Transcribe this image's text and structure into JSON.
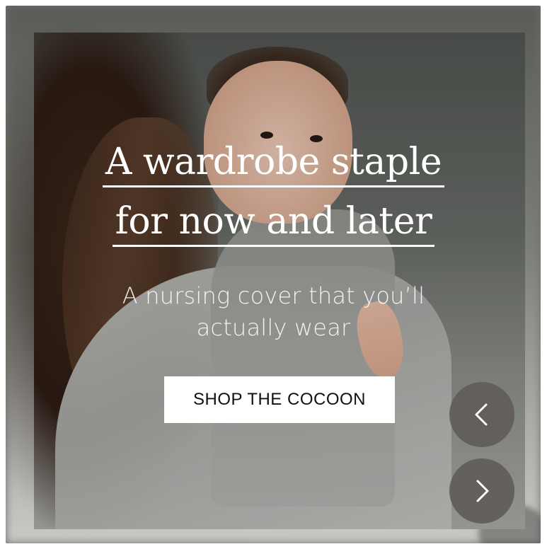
{
  "hero": {
    "headline_line1": "A wardrobe staple",
    "headline_line2": "for now and later",
    "subhead_line1": "A nursing cover that you’ll",
    "subhead_line2": "actually wear",
    "cta_label": "SHOP THE COCOON"
  },
  "carousel": {
    "prev_icon": "chevron-left-icon",
    "next_icon": "chevron-right-icon"
  },
  "colors": {
    "text": "#ffffff",
    "cta_bg": "#ffffff",
    "cta_text": "#111111",
    "nav_bg": "#5f5c5a"
  }
}
